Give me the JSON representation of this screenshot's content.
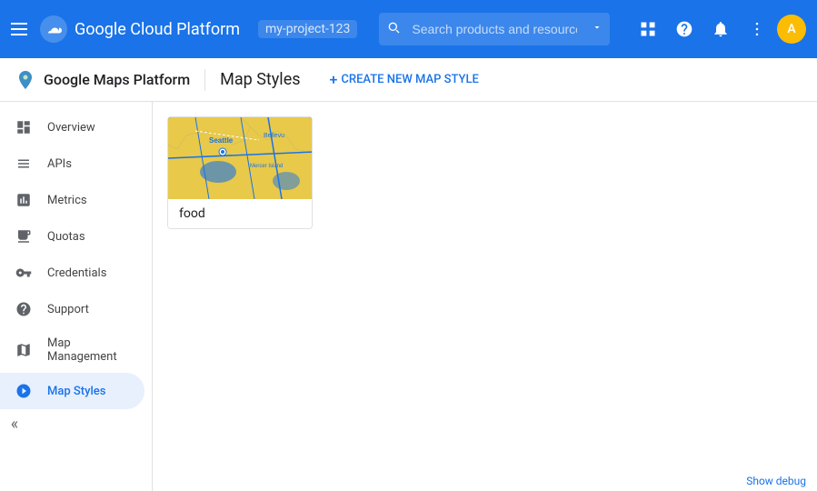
{
  "header": {
    "menu_icon": "menu-icon",
    "app_name": "Google Cloud Platform",
    "project_name": "my-project-123",
    "search_placeholder": "Search products and resources",
    "icons": {
      "apps": "⊞",
      "help": "?",
      "notifications": "🔔",
      "more": "⋮"
    },
    "avatar_text": "A"
  },
  "sub_header": {
    "logo_alt": "Google Maps",
    "title": "Google Maps Platform",
    "page_title": "Map Styles",
    "create_btn_label": "CREATE NEW MAP STYLE"
  },
  "sidebar": {
    "items": [
      {
        "id": "overview",
        "label": "Overview",
        "icon": "○"
      },
      {
        "id": "apis",
        "label": "APIs",
        "icon": "≡"
      },
      {
        "id": "metrics",
        "label": "Metrics",
        "icon": "📊"
      },
      {
        "id": "quotas",
        "label": "Quotas",
        "icon": "▭"
      },
      {
        "id": "credentials",
        "label": "Credentials",
        "icon": "🔑"
      },
      {
        "id": "support",
        "label": "Support",
        "icon": "👤"
      },
      {
        "id": "map-management",
        "label": "Map Management",
        "icon": "🗂"
      },
      {
        "id": "map-styles",
        "label": "Map Styles",
        "icon": "◎",
        "active": true
      }
    ],
    "collapse_icon": "«"
  },
  "content": {
    "map_styles": [
      {
        "id": "food",
        "label": "food",
        "has_thumbnail": true
      }
    ]
  },
  "footer": {
    "debug_label": "Show debug"
  }
}
